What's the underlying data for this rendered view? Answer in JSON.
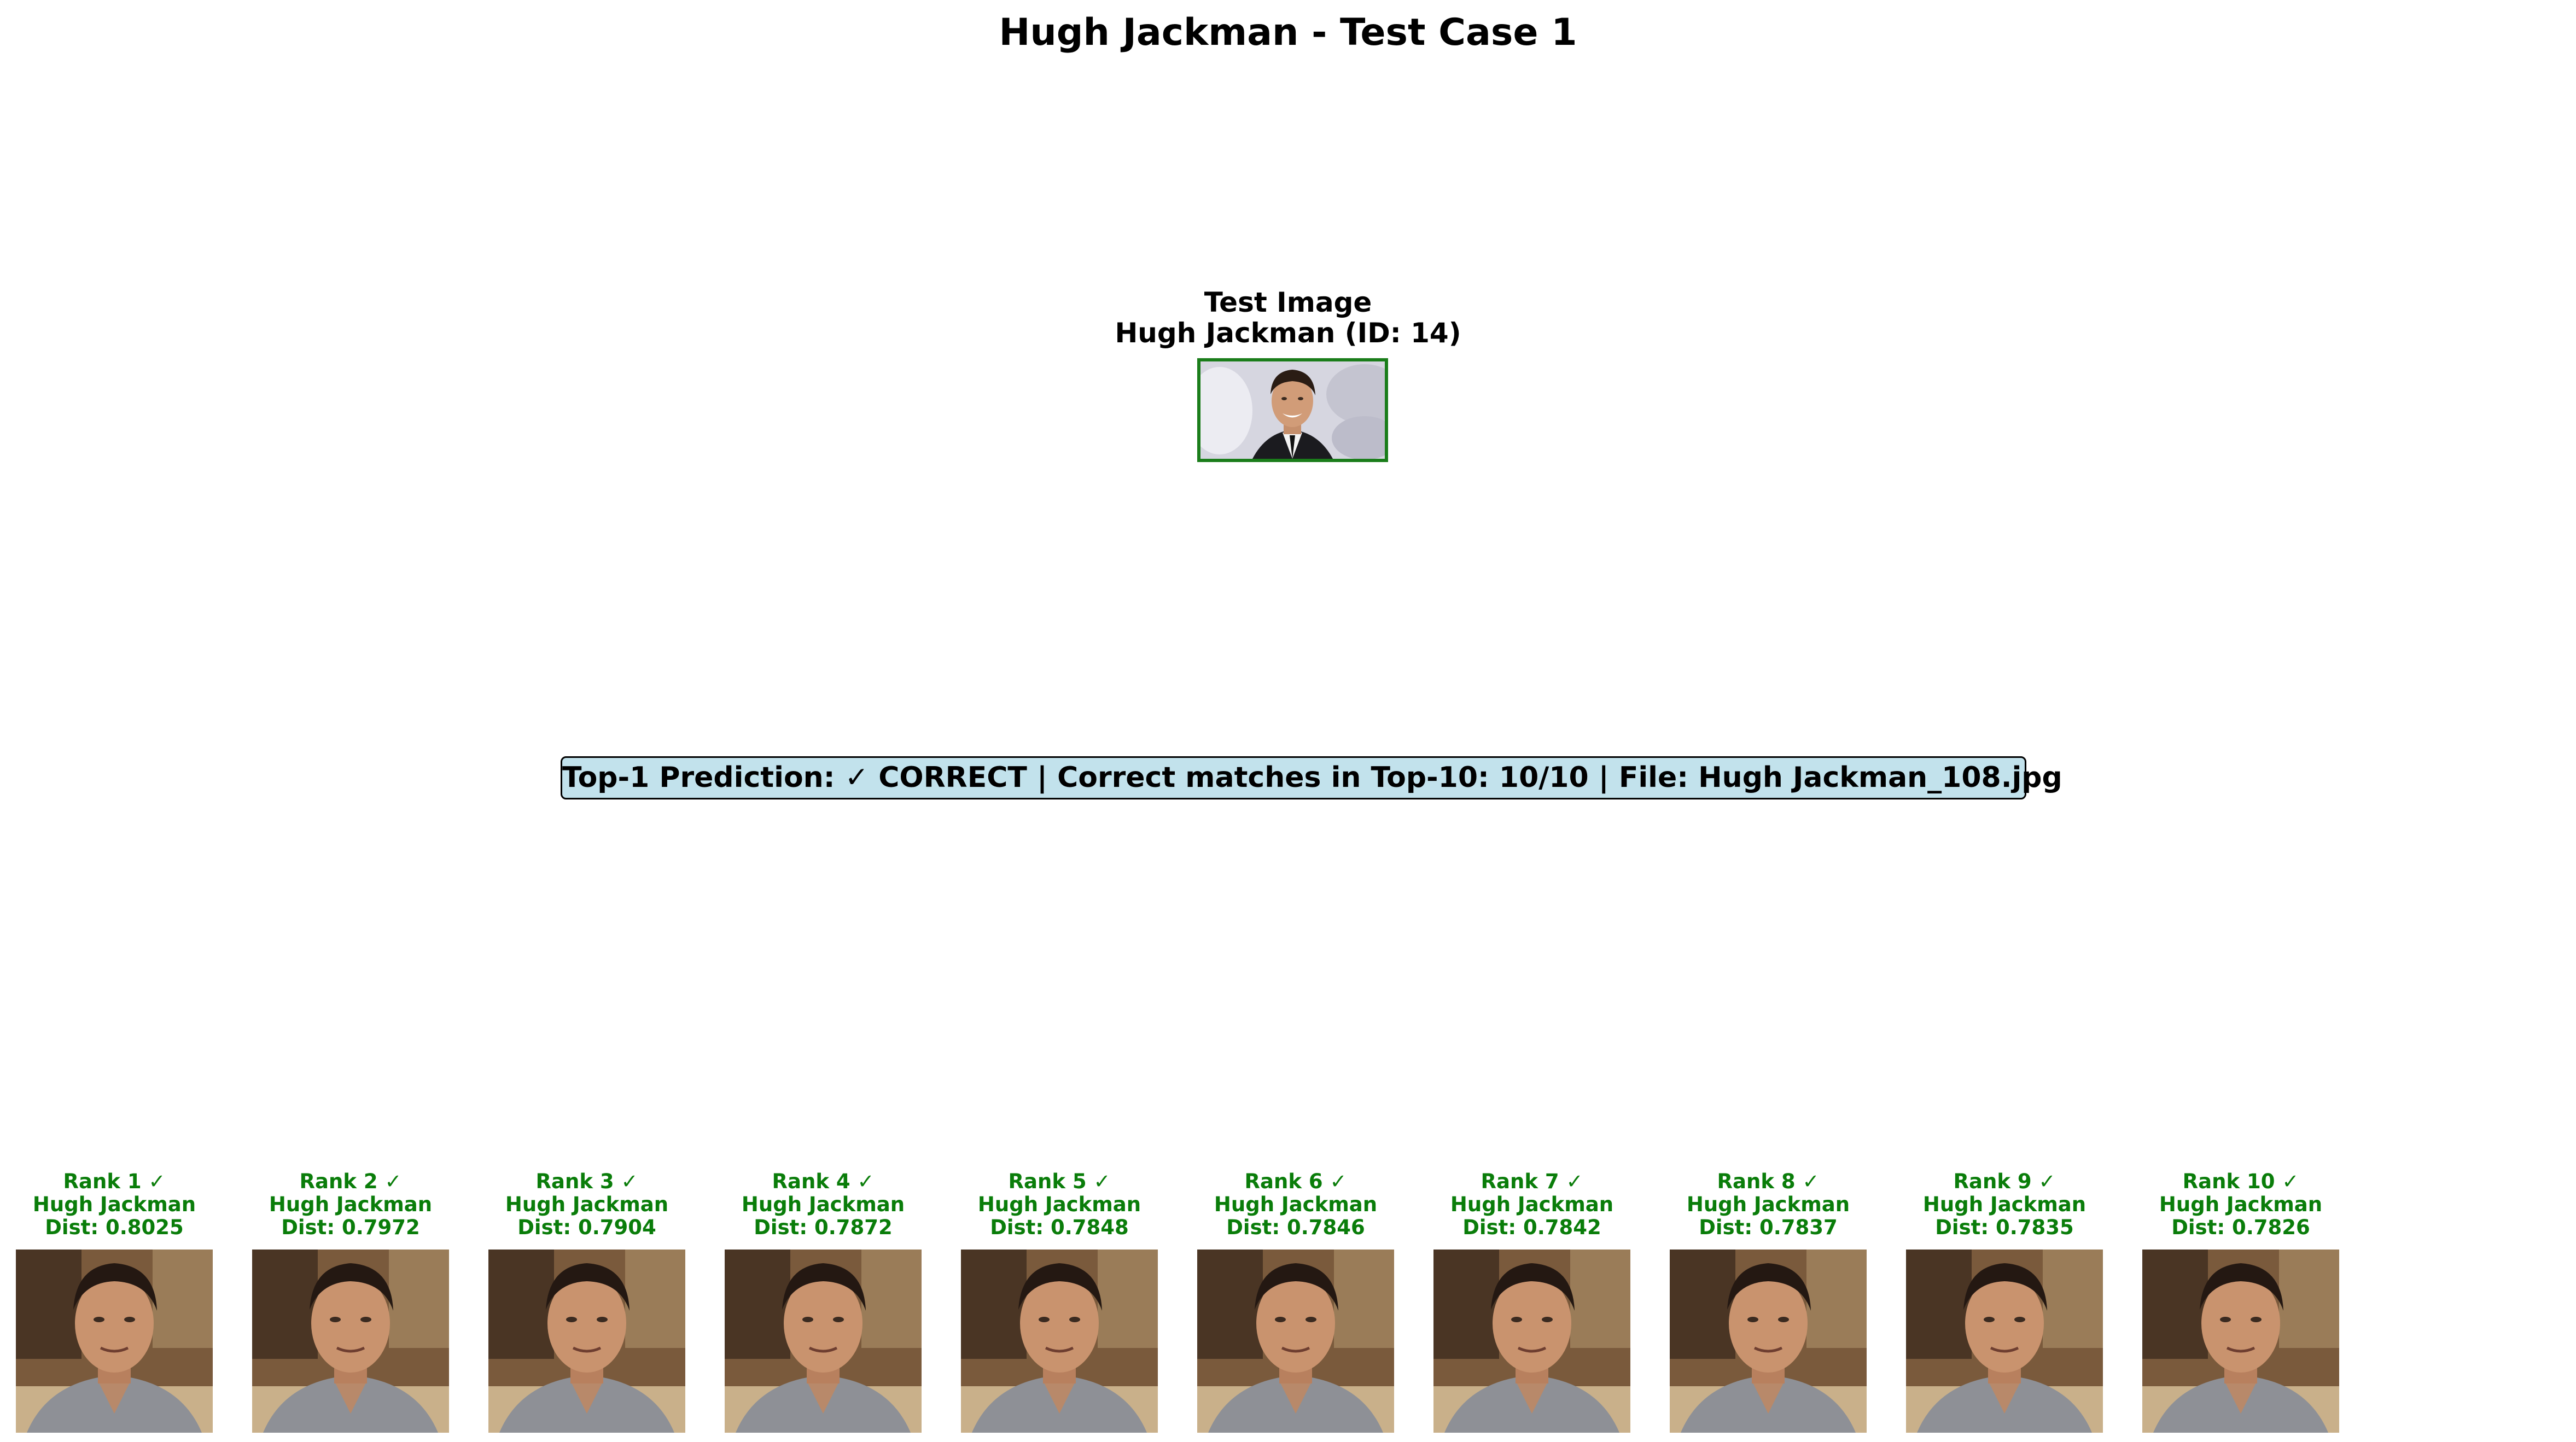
{
  "title": "Hugh Jackman - Test Case 1",
  "test_image": {
    "title_line1": "Test Image",
    "title_line2": "Hugh Jackman (ID: 14)"
  },
  "summary": "Top-1 Prediction: ✓ CORRECT | Correct matches in Top-10: 10/10 | File: Hugh Jackman_108.jpg",
  "colors": {
    "correct": "#0a7d0a",
    "summary_bg": "#add8e6"
  },
  "ranks": [
    {
      "rank": "Rank 1 ✓",
      "name": "Hugh Jackman",
      "dist": "Dist: 0.8025"
    },
    {
      "rank": "Rank 2 ✓",
      "name": "Hugh Jackman",
      "dist": "Dist: 0.7972"
    },
    {
      "rank": "Rank 3 ✓",
      "name": "Hugh Jackman",
      "dist": "Dist: 0.7904"
    },
    {
      "rank": "Rank 4 ✓",
      "name": "Hugh Jackman",
      "dist": "Dist: 0.7872"
    },
    {
      "rank": "Rank 5 ✓",
      "name": "Hugh Jackman",
      "dist": "Dist: 0.7848"
    },
    {
      "rank": "Rank 6 ✓",
      "name": "Hugh Jackman",
      "dist": "Dist: 0.7846"
    },
    {
      "rank": "Rank 7 ✓",
      "name": "Hugh Jackman",
      "dist": "Dist: 0.7842"
    },
    {
      "rank": "Rank 8 ✓",
      "name": "Hugh Jackman",
      "dist": "Dist: 0.7837"
    },
    {
      "rank": "Rank 9 ✓",
      "name": "Hugh Jackman",
      "dist": "Dist: 0.7835"
    },
    {
      "rank": "Rank 10 ✓",
      "name": "Hugh Jackman",
      "dist": "Dist: 0.7826"
    }
  ]
}
